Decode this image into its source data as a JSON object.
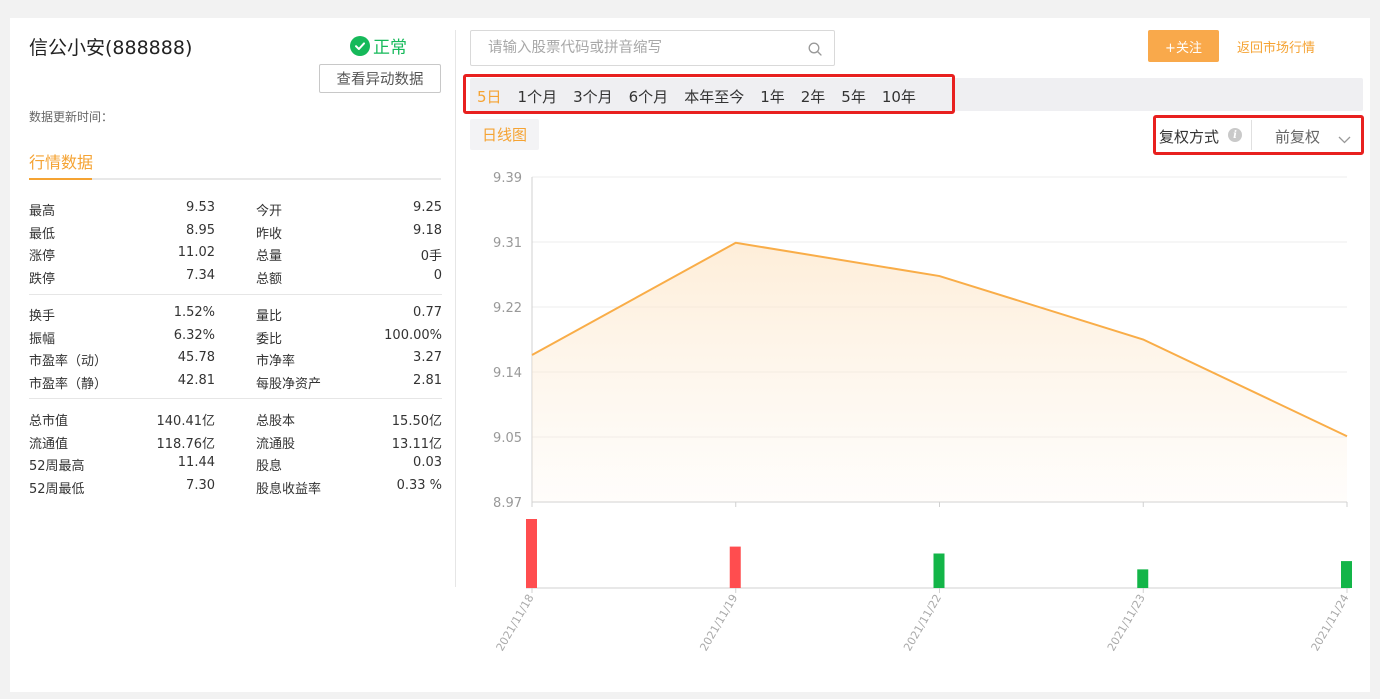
{
  "stock": {
    "title": "信公小安(888888)",
    "status": "正常",
    "status_color": "#16b95a"
  },
  "anomaly_button": "查看异动数据",
  "update_time_label": "数据更新时间：",
  "market_tab": "行情数据",
  "stats": [
    [
      {
        "l1": "最高",
        "v1": "9.53",
        "l2": "今开",
        "v2": "9.25"
      },
      {
        "l1": "最低",
        "v1": "8.95",
        "l2": "昨收",
        "v2": "9.18"
      },
      {
        "l1": "涨停",
        "v1": "11.02",
        "l2": "总量",
        "v2": "0手"
      },
      {
        "l1": "跌停",
        "v1": "7.34",
        "l2": "总额",
        "v2": "0"
      }
    ],
    [
      {
        "l1": "换手",
        "v1": "1.52%",
        "l2": "量比",
        "v2": "0.77"
      },
      {
        "l1": "振幅",
        "v1": "6.32%",
        "l2": "委比",
        "v2": "100.00%"
      },
      {
        "l1": "市盈率（动）",
        "v1": "45.78",
        "l2": "市净率",
        "v2": "3.27"
      },
      {
        "l1": "市盈率（静）",
        "v1": "42.81",
        "l2": "每股净资产",
        "v2": "2.81"
      }
    ],
    [
      {
        "l1": "总市值",
        "v1": "140.41亿",
        "l2": "总股本",
        "v2": "15.50亿"
      },
      {
        "l1": "流通值",
        "v1": "118.76亿",
        "l2": "流通股",
        "v2": "13.11亿"
      },
      {
        "l1": "52周最高",
        "v1": "11.44",
        "l2": "股息",
        "v2": "0.03"
      },
      {
        "l1": "52周最低",
        "v1": "7.30",
        "l2": "股息收益率",
        "v2": "0.33 %"
      }
    ]
  ],
  "search": {
    "placeholder": "请输入股票代码或拼音缩写",
    "value": ""
  },
  "follow_button": "+关注",
  "back_link": "返回市场行情",
  "ranges": [
    "5日",
    "1个月",
    "3个月",
    "6个月",
    "本年至今",
    "1年",
    "2年",
    "5年",
    "10年"
  ],
  "active_range": "5日",
  "chart_type_button": "日线图",
  "adjust": {
    "label": "复权方式",
    "value": "前复权"
  },
  "colors": {
    "accent": "#f5a333",
    "up": "#ff4d4f",
    "down": "#13b548",
    "highlight_box": "#e8201f"
  },
  "chart_data": {
    "type": "area",
    "x": [
      "2021/11/18",
      "2021/11/19",
      "2021/11/22",
      "2021/11/23",
      "2021/11/24"
    ],
    "series": [
      {
        "values": [
          9.16,
          9.305,
          9.262,
          9.18,
          9.055
        ]
      }
    ],
    "yticks": [
      "9.39",
      "9.31",
      "9.22",
      "9.14",
      "9.05",
      "8.97"
    ],
    "ylim": [
      8.97,
      9.39
    ],
    "volume": {
      "values": [
        1.0,
        0.6,
        0.5,
        0.27,
        0.39
      ],
      "direction": [
        "up",
        "up",
        "down",
        "down",
        "down"
      ]
    }
  }
}
